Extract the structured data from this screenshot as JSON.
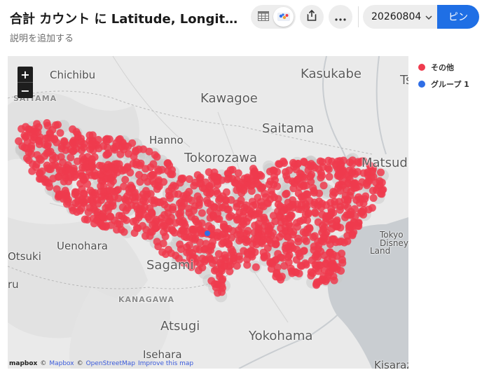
{
  "header": {
    "title": "合計 カウント に Latitude, Longitude …",
    "subtitle": "説明を追加する",
    "version": "20260804",
    "pin_label": "ピン",
    "icons": {
      "table": "table-icon",
      "map": "map-icon",
      "share": "share-icon",
      "more": "more-icon",
      "chevron": "chevron-down-icon"
    }
  },
  "map": {
    "zoom_in": "+",
    "zoom_out": "−",
    "labels": {
      "chichibu": "Chichibu",
      "saitama_region": "SAITAMA",
      "kasukabe": "Kasukabe",
      "kawagoe": "Kawagoe",
      "saitama": "Saitama",
      "hanno": "Hanno",
      "tokorozawa": "Tokorozawa",
      "matsudo": "Matsudo",
      "uenohara": "Uenohara",
      "otsuki": "Otsuki",
      "ru": "ru",
      "sagami": "Sagami",
      "kanagawa": "KANAGAWA",
      "atsugi": "Atsugi",
      "yokohama": "Yokohama",
      "isehara": "Isehara",
      "kisaraz": "Kisaraz",
      "disney_tokyo": "Tokyo",
      "disney": "Disney",
      "disney_land": "Land",
      "ts": "Ts"
    },
    "attribution": {
      "logo": "mapbox",
      "copy1": "©",
      "mapbox": "Mapbox",
      "copy2": "©",
      "osm": "OpenStreetMap",
      "improve": "Improve this map"
    }
  },
  "legend": [
    {
      "label": "その他",
      "color": "#ef3b4e"
    },
    {
      "label": "グループ 1",
      "color": "#2f6ee6"
    }
  ],
  "colors": {
    "accent": "#1f6fe5",
    "points_other": "#ef3b4e",
    "points_group1": "#2f6ee6",
    "water": "#c9cdd1"
  }
}
